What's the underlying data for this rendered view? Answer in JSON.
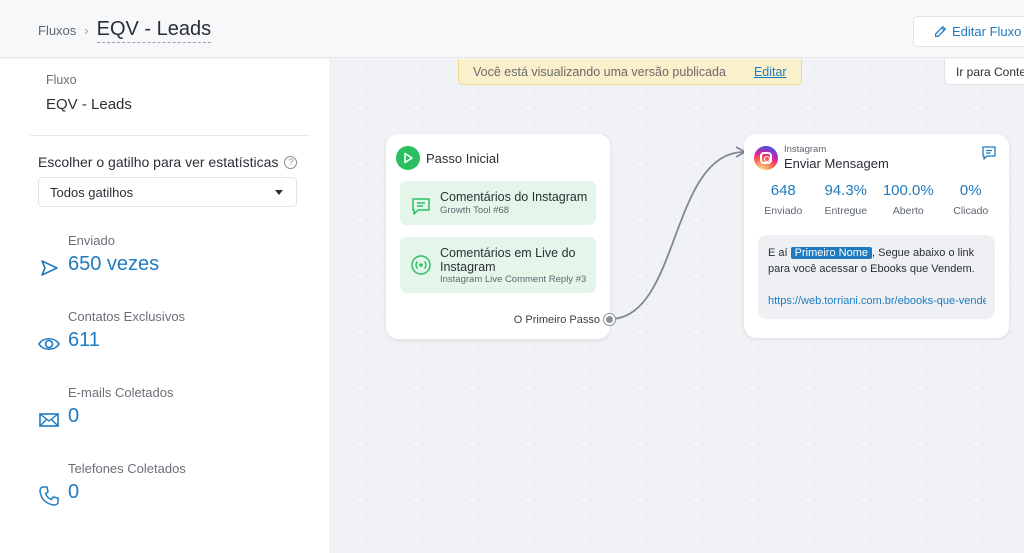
{
  "header": {
    "breadcrumb_parent": "Fluxos",
    "breadcrumb_sep": "›",
    "title": "EQV - Leads",
    "edit_button": "Editar Fluxo"
  },
  "sidebar": {
    "flow_label": "Fluxo",
    "flow_name": "EQV - Leads",
    "trigger_label": "Escolher o gatilho para ver estatísticas",
    "help": "?",
    "trigger_select_value": "Todos gatilhos",
    "stats": [
      {
        "label": "Enviado",
        "value": "650 vezes",
        "icon": "send-icon"
      },
      {
        "label": "Contatos Exclusivos",
        "value": "611",
        "icon": "eye-icon"
      },
      {
        "label": "E-mails Coletados",
        "value": "0",
        "icon": "mail-icon"
      },
      {
        "label": "Telefones Coletados",
        "value": "0",
        "icon": "phone-icon"
      }
    ]
  },
  "canvas": {
    "notice_text": "Você está visualizando uma versão publicada",
    "notice_link": "Editar",
    "goto_button": "Ir para Conteúdo",
    "start_node": {
      "title": "Passo Inicial",
      "triggers": [
        {
          "title": "Comentários do Instagram",
          "subtitle": "Growth Tool #68",
          "icon": "comment-icon"
        },
        {
          "title": "Comentários em Live do Instagram",
          "subtitle": "Instagram Live Comment Reply #3",
          "icon": "live-icon"
        }
      ],
      "output_label": "O Primeiro Passo"
    },
    "message_node": {
      "channel": "Instagram",
      "title": "Enviar Mensagem",
      "metrics": [
        {
          "value": "648",
          "label": "Enviado"
        },
        {
          "value": "94.3%",
          "label": "Entregue"
        },
        {
          "value": "100.0%",
          "label": "Aberto"
        },
        {
          "value": "0%",
          "label": "Clicado"
        }
      ],
      "message_prefix": "E aí",
      "message_tag": "Primeiro Nome",
      "message_suffix": ", Segue abaixo o link para você acessar o Ebooks que Vendem.",
      "message_link": "https://web.torriani.com.br/ebooks-que-vendem"
    }
  },
  "colors": {
    "accent": "#1f7bc0",
    "start_green": "#2cbf62",
    "trigger_bg": "#e4f6e9",
    "notice_bg": "#fbf0cc"
  }
}
